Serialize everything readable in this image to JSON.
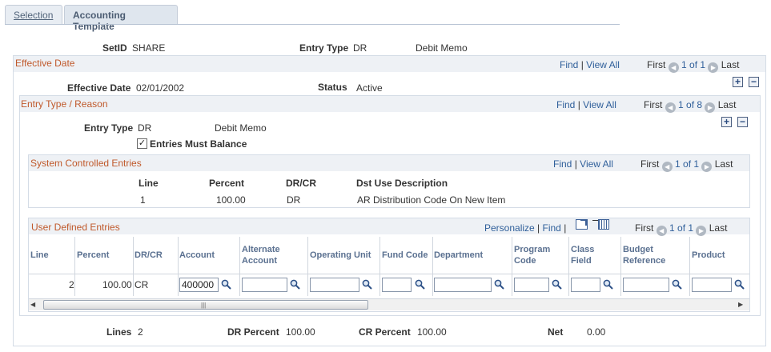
{
  "tabs": {
    "selection": "Selection",
    "accounting_template": "Accounting Template"
  },
  "header": {
    "setid_label": "SetID",
    "setid_value": "SHARE",
    "entry_type_label": "Entry Type",
    "entry_type_value": "DR",
    "entry_type_desc": "Debit Memo"
  },
  "effective_date": {
    "title": "Effective Date",
    "find": "Find",
    "sep": "|",
    "view_all": "View All",
    "first": "First",
    "count": "1 of 1",
    "last": "Last",
    "date_label": "Effective Date",
    "date_value": "02/01/2002",
    "status_label": "Status",
    "status_value": "Active"
  },
  "entry_type_reason": {
    "title": "Entry Type / Reason",
    "find": "Find",
    "sep": "|",
    "view_all": "View All",
    "first": "First",
    "count": "1 of 8",
    "last": "Last",
    "entry_type_label": "Entry Type",
    "entry_type_value": "DR",
    "entry_type_desc": "Debit Memo",
    "balance_label": "Entries Must Balance",
    "balance_checked": "✓"
  },
  "system_entries": {
    "title": "System Controlled Entries",
    "find": "Find",
    "sep": "|",
    "view_all": "View All",
    "first": "First",
    "count": "1 of 1",
    "last": "Last",
    "headers": {
      "line": "Line",
      "percent": "Percent",
      "drcr": "DR/CR",
      "desc": "Dst Use Description"
    },
    "row": {
      "line": "1",
      "percent": "100.00",
      "drcr": "DR",
      "desc": "AR Distribution Code On New Item"
    }
  },
  "user_entries": {
    "title": "User Defined Entries",
    "personalize": "Personalize",
    "sep": "|",
    "find": "Find",
    "first": "First",
    "count": "1 of 1",
    "last": "Last",
    "headers": {
      "line": "Line",
      "percent": "Percent",
      "drcr": "DR/CR",
      "account": "Account",
      "alt_account_1": "Alternate",
      "alt_account_2": "Account",
      "operating_unit": "Operating Unit",
      "fund_code": "Fund Code",
      "department": "Department",
      "program_code_1": "Program",
      "program_code_2": "Code",
      "class_field_1": "Class",
      "class_field_2": "Field",
      "budget_ref_1": "Budget",
      "budget_ref_2": "Reference",
      "product": "Product"
    },
    "row": {
      "line": "2",
      "percent": "100.00",
      "drcr": "CR",
      "account": "400000"
    }
  },
  "totals": {
    "lines_label": "Lines",
    "lines_value": "2",
    "dr_label": "DR Percent",
    "dr_value": "100.00",
    "cr_label": "CR Percent",
    "cr_value": "100.00",
    "net_label": "Net",
    "net_value": "0.00"
  },
  "colors": {
    "section_title": "#c0592b",
    "link": "#2f5f9a",
    "grid_header": "#5a7090"
  }
}
